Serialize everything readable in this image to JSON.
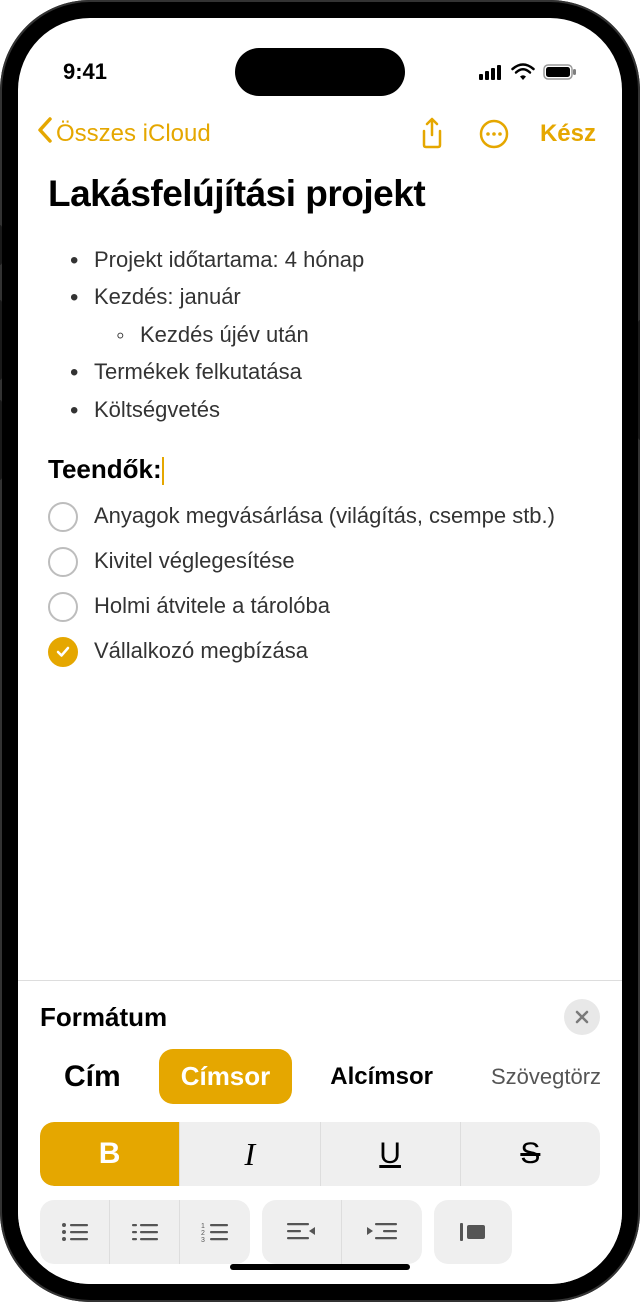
{
  "status": {
    "time": "9:41"
  },
  "nav": {
    "back_label": "Összes iCloud",
    "done_label": "Kész"
  },
  "note": {
    "title": "Lakásfelújítási projekt",
    "bullets": [
      "Projekt időtartama: 4 hónap",
      "Kezdés: január",
      "Termékek felkutatása",
      "Költségvetés"
    ],
    "sub_bullet": "Kezdés újév után",
    "heading": "Teendők:",
    "checklist": [
      {
        "text": "Anyagok megvásárlása (világítás, csempe stb.)",
        "checked": false
      },
      {
        "text": "Kivitel véglegesítése",
        "checked": false
      },
      {
        "text": "Holmi átvitele a tárolóba",
        "checked": false
      },
      {
        "text": "Vállalkozó megbízása",
        "checked": true
      }
    ]
  },
  "format": {
    "title": "Formátum",
    "styles": {
      "title": "Cím",
      "heading": "Címsor",
      "subheading": "Alcímsor",
      "body": "Szövegtörzs"
    },
    "bius": {
      "b": "B",
      "i": "I",
      "u": "U",
      "s": "S"
    }
  },
  "colors": {
    "accent": "#e5a700"
  }
}
